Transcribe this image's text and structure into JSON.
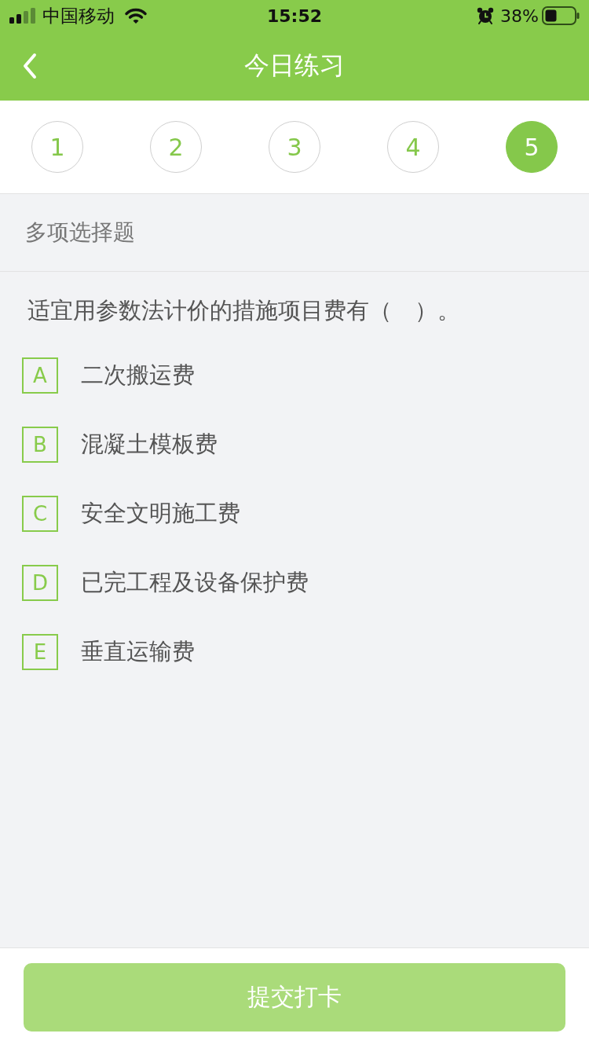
{
  "status_bar": {
    "carrier": "中国移动",
    "time": "15:52",
    "battery": "38%"
  },
  "nav": {
    "title": "今日练习"
  },
  "steps": [
    {
      "label": "1",
      "selected": false
    },
    {
      "label": "2",
      "selected": false
    },
    {
      "label": "3",
      "selected": false
    },
    {
      "label": "4",
      "selected": false
    },
    {
      "label": "5",
      "selected": true
    }
  ],
  "section": {
    "title": "多项选择题"
  },
  "question": {
    "text": "适宜用参数法计价的措施项目费有（　）。",
    "options": [
      {
        "letter": "A",
        "text": "二次搬运费",
        "selected": false
      },
      {
        "letter": "B",
        "text": "混凝土模板费",
        "selected": false
      },
      {
        "letter": "C",
        "text": "安全文明施工费",
        "selected": false
      },
      {
        "letter": "D",
        "text": "已完工程及设备保护费",
        "selected": false
      },
      {
        "letter": "E",
        "text": "垂直运输费",
        "selected": false
      }
    ]
  },
  "submit": {
    "label": "提交打卡",
    "disabled": true
  }
}
